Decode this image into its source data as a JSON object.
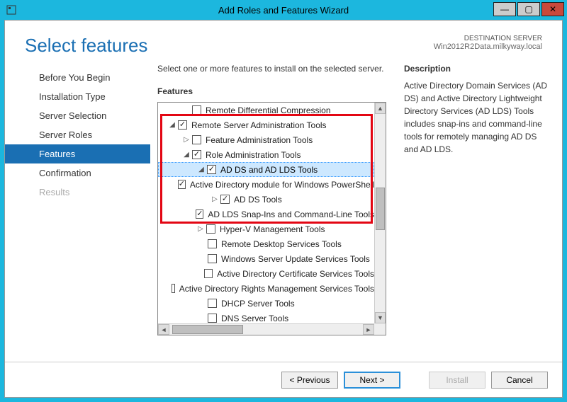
{
  "window": {
    "title": "Add Roles and Features Wizard"
  },
  "header": {
    "page_title": "Select features",
    "dest_label": "DESTINATION SERVER",
    "dest_server": "Win2012R2Data.milkyway.local"
  },
  "sidebar": {
    "items": [
      {
        "label": "Before You Begin",
        "active": false,
        "disabled": false
      },
      {
        "label": "Installation Type",
        "active": false,
        "disabled": false
      },
      {
        "label": "Server Selection",
        "active": false,
        "disabled": false
      },
      {
        "label": "Server Roles",
        "active": false,
        "disabled": false
      },
      {
        "label": "Features",
        "active": true,
        "disabled": false
      },
      {
        "label": "Confirmation",
        "active": false,
        "disabled": false
      },
      {
        "label": "Results",
        "active": false,
        "disabled": true
      }
    ]
  },
  "main": {
    "instruction": "Select one or more features to install on the selected server.",
    "features_label": "Features",
    "description_label": "Description",
    "description_text": "Active Directory Domain Services (AD DS) and Active Directory Lightweight Directory Services (AD LDS) Tools includes snap-ins and command-line tools for remotely managing AD DS and AD LDS.",
    "tree": [
      {
        "indent": 34,
        "expander": "",
        "checked": false,
        "label": "Remote Differential Compression"
      },
      {
        "indent": 14,
        "expander": "expanded",
        "checked": true,
        "label": "Remote Server Administration Tools"
      },
      {
        "indent": 34,
        "expander": "collapsed",
        "checked": false,
        "label": "Feature Administration Tools"
      },
      {
        "indent": 34,
        "expander": "expanded",
        "checked": true,
        "label": "Role Administration Tools"
      },
      {
        "indent": 54,
        "expander": "expanded",
        "checked": true,
        "label": "AD DS and AD LDS Tools",
        "selected": true
      },
      {
        "indent": 76,
        "expander": "",
        "checked": true,
        "label": "Active Directory module for Windows PowerShell"
      },
      {
        "indent": 74,
        "expander": "collapsed",
        "checked": true,
        "label": "AD DS Tools"
      },
      {
        "indent": 76,
        "expander": "",
        "checked": true,
        "label": "AD LDS Snap-Ins and Command-Line Tools"
      },
      {
        "indent": 54,
        "expander": "collapsed",
        "checked": false,
        "label": "Hyper-V Management Tools"
      },
      {
        "indent": 56,
        "expander": "",
        "checked": false,
        "label": "Remote Desktop Services Tools"
      },
      {
        "indent": 56,
        "expander": "",
        "checked": false,
        "label": "Windows Server Update Services Tools"
      },
      {
        "indent": 56,
        "expander": "",
        "checked": false,
        "label": "Active Directory Certificate Services Tools"
      },
      {
        "indent": 56,
        "expander": "",
        "checked": false,
        "label": "Active Directory Rights Management Services Tools"
      },
      {
        "indent": 56,
        "expander": "",
        "checked": false,
        "label": "DHCP Server Tools"
      },
      {
        "indent": 56,
        "expander": "",
        "checked": false,
        "label": "DNS Server Tools"
      }
    ]
  },
  "footer": {
    "previous": "< Previous",
    "next": "Next >",
    "install": "Install",
    "cancel": "Cancel"
  }
}
